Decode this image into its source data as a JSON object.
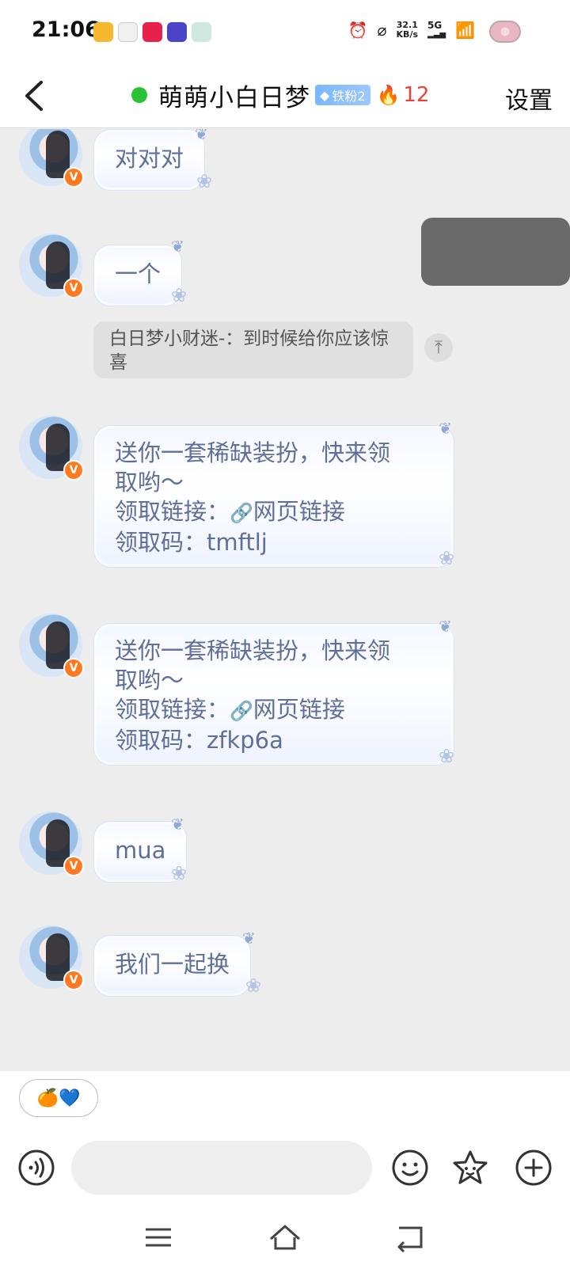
{
  "status_bar": {
    "time": "21:06",
    "net_speed_value": "32.1",
    "net_speed_unit": "KB/s",
    "network": "5G"
  },
  "header": {
    "title": "萌萌小白日梦",
    "badge_label": "铁粉2",
    "fire_count": "12",
    "settings_label": "设置",
    "online_color": "#2ac234"
  },
  "messages": [
    {
      "text": "对对对"
    },
    {
      "text": "一个"
    },
    {
      "quote": "白日梦小财迷-：到时候给你应该惊喜"
    },
    {
      "line1": "送你一套稀缺装扮，快来领",
      "line2": "取哟～",
      "link_prefix": "领取链接：",
      "link_text": "网页链接",
      "code_prefix": "领取码：",
      "code": "tmftlj"
    },
    {
      "line1": "送你一套稀缺装扮，快来领",
      "line2": "取哟～",
      "link_prefix": "领取链接：",
      "link_text": "网页链接",
      "code_prefix": "领取码：",
      "code": "zfkp6a"
    },
    {
      "text": "mua"
    },
    {
      "text": "我们一起换"
    }
  ],
  "input": {
    "quick_reply": "🍊💙",
    "value": ""
  },
  "icons": {
    "accent": "#ff7a1f",
    "bubble_text": "#5f6f9a"
  }
}
